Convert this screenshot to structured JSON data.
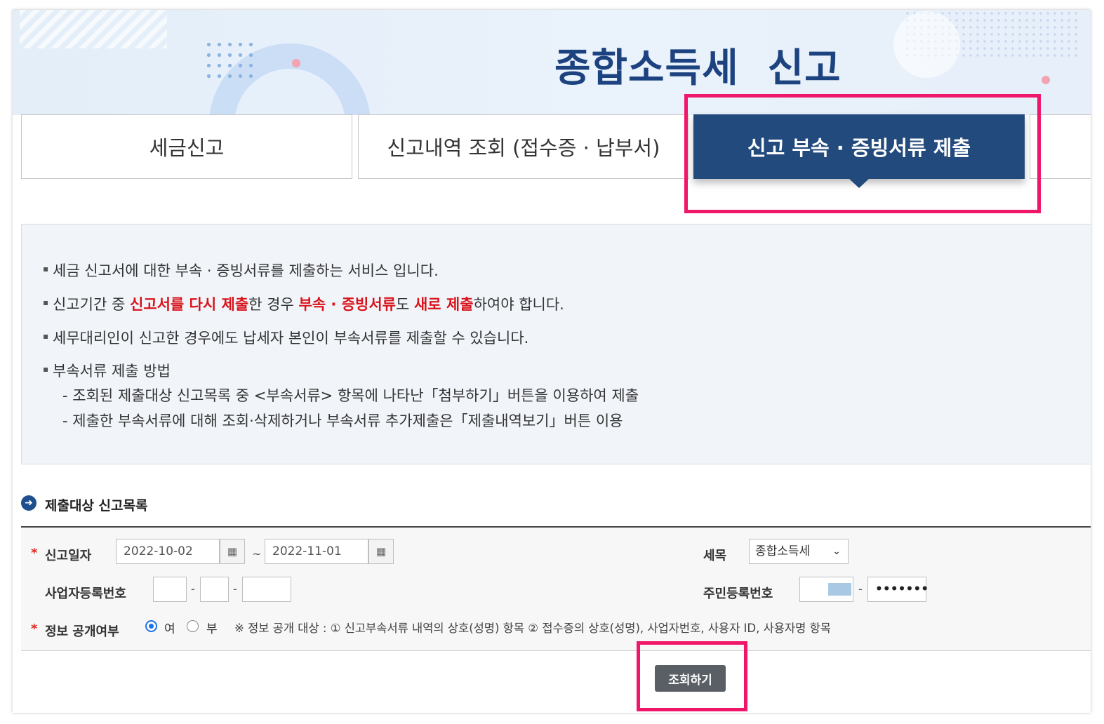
{
  "banner": {
    "title": "종합소득세  신고"
  },
  "tabs": [
    {
      "label": "세금신고",
      "active": false
    },
    {
      "label": "신고내역 조회 (접수증 · 납부서)",
      "active": false
    },
    {
      "label": "신고 부속 · 증빙서류 제출",
      "active": true
    }
  ],
  "info": {
    "line1": "세금 신고서에 대한 부속 · 증빙서류를 제출하는 서비스 입니다.",
    "line2": {
      "p1": "신고기간 중 ",
      "r1": "신고서를 다시 제출",
      "p2": "한 경우 ",
      "r2": "부속 · 증빙서류",
      "p3": "도 ",
      "r3": "새로 제출",
      "p4": "하여야 합니다."
    },
    "line3": "세무대리인이 신고한 경우에도 납세자 본인이 부속서류를 제출할 수 있습니다.",
    "line4": "부속서류 제출 방법",
    "sub1": "- 조회된 제출대상 신고목록 중 <부속서류> 항목에 나타난「첨부하기」버튼을 이용하여 제출",
    "sub2": "- 제출한 부속서류에 대해 조회·삭제하거나 부속서류 추가제출은「제출내역보기」버튼 이용"
  },
  "section": {
    "title": "제출대상 신고목록"
  },
  "form": {
    "required_mark": "*",
    "filing_date_label": "신고일자",
    "date_from": "2022-10-02",
    "date_to": "2022-11-01",
    "date_sep": "~",
    "tax_item_label": "세목",
    "tax_item_value": "종합소득세",
    "brn_label": "사업자등록번호",
    "dash": "-",
    "rrn_label": "주민등록번호",
    "rrn_back": "•••••••",
    "disclosure_label": "정보 공개여부",
    "opt_yes": "여",
    "opt_no": "부",
    "disclosure_selected": "여",
    "note": "※ 정보 공개 대상 : ① 신고부속서류 내역의 상호(성명) 항목 ② 접수증의 상호(성명), 사업자번호, 사용자 ID, 사용자명 항목"
  },
  "search_button": "조회하기",
  "colors": {
    "accent": "#234a7d",
    "highlight": "#f0166a",
    "emphasis": "#d9131b"
  }
}
